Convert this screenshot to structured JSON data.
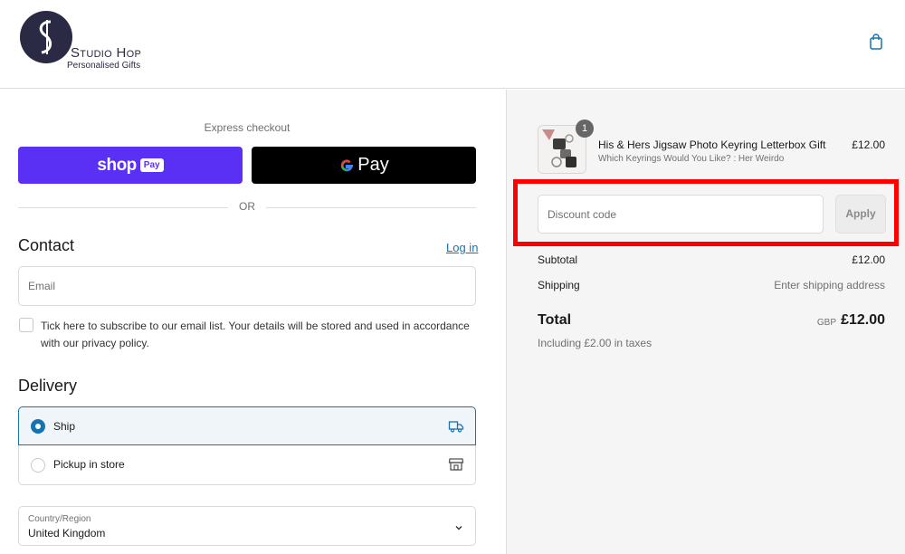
{
  "header": {
    "brand_name": "Studio Hop",
    "brand_tagline": "Personalised Gifts",
    "cart_icon": "shopping-bag-icon"
  },
  "express": {
    "label": "Express checkout",
    "shop_pay_word": "shop",
    "shop_pay_badge": "Pay",
    "gpay_letter": "G",
    "gpay_word": "Pay",
    "or_text": "OR"
  },
  "contact": {
    "heading": "Contact",
    "login_link": "Log in",
    "email_placeholder": "Email",
    "email_value": "",
    "subscribe_label": "Tick here to subscribe to our email list. Your details will be stored and used in accordance with our privacy policy."
  },
  "delivery": {
    "heading": "Delivery",
    "options": [
      {
        "label": "Ship",
        "selected": true,
        "icon": "truck-icon"
      },
      {
        "label": "Pickup in store",
        "selected": false,
        "icon": "store-icon"
      }
    ],
    "country_label": "Country/Region",
    "country_value": "United Kingdom"
  },
  "summary": {
    "item": {
      "quantity": "1",
      "title": "His & Hers Jigsaw Photo Keyring Letterbox Gift",
      "variant": "Which Keyrings Would You Like? : Her Weirdo",
      "price": "£12.00"
    },
    "discount_placeholder": "Discount code",
    "apply_label": "Apply",
    "subtotal_label": "Subtotal",
    "subtotal_value": "£12.00",
    "shipping_label": "Shipping",
    "shipping_value": "Enter shipping address",
    "total_label": "Total",
    "total_currency": "GBP",
    "total_value": "£12.00",
    "tax_note": "Including £2.00 in taxes"
  },
  "colors": {
    "shop_pay": "#5a31f4",
    "gpay": "#000000",
    "link": "#1773b0",
    "highlight": "#ff0000",
    "logo": "#2b2a44"
  }
}
